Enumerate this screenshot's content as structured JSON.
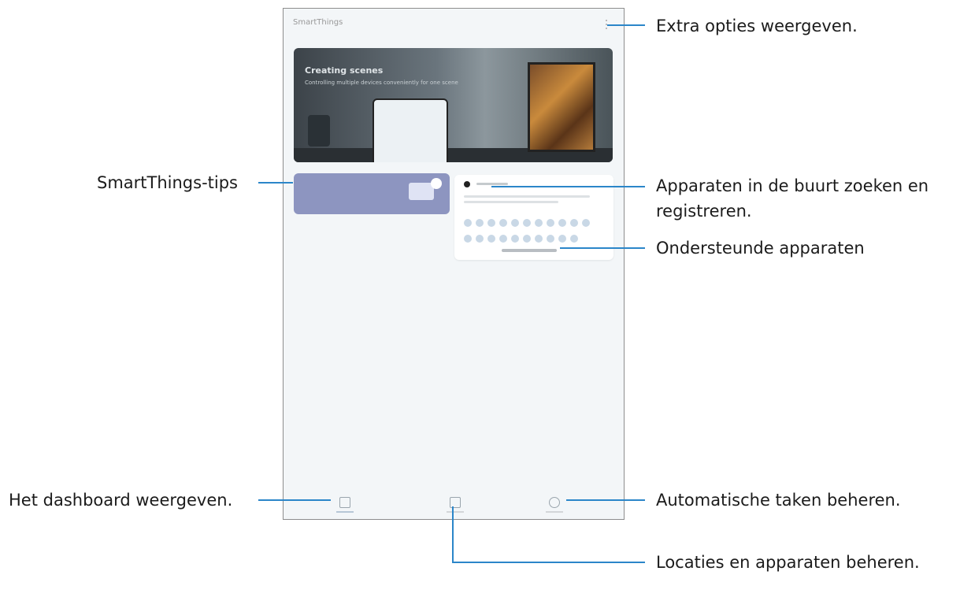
{
  "device": {
    "app_title": "SmartThings",
    "banner_title": "Creating scenes",
    "banner_subtitle": "Controlling multiple devices conveniently for one scene"
  },
  "callouts": {
    "extra_options": "Extra opties weergeven.",
    "tips": "SmartThings-tips",
    "nearby_line1": "Apparaten in de buurt zoeken en",
    "nearby_line2": "registreren.",
    "supported": "Ondersteunde apparaten",
    "dashboard": "Het dashboard weergeven.",
    "automations": "Automatische taken beheren.",
    "locations": "Locaties en apparaten beheren."
  },
  "colors": {
    "leader": "#2b86c9",
    "tips_card": "#8d95c0"
  },
  "icons": [
    "more-options-icon",
    "dashboard-icon",
    "devices-icon",
    "automations-icon"
  ]
}
